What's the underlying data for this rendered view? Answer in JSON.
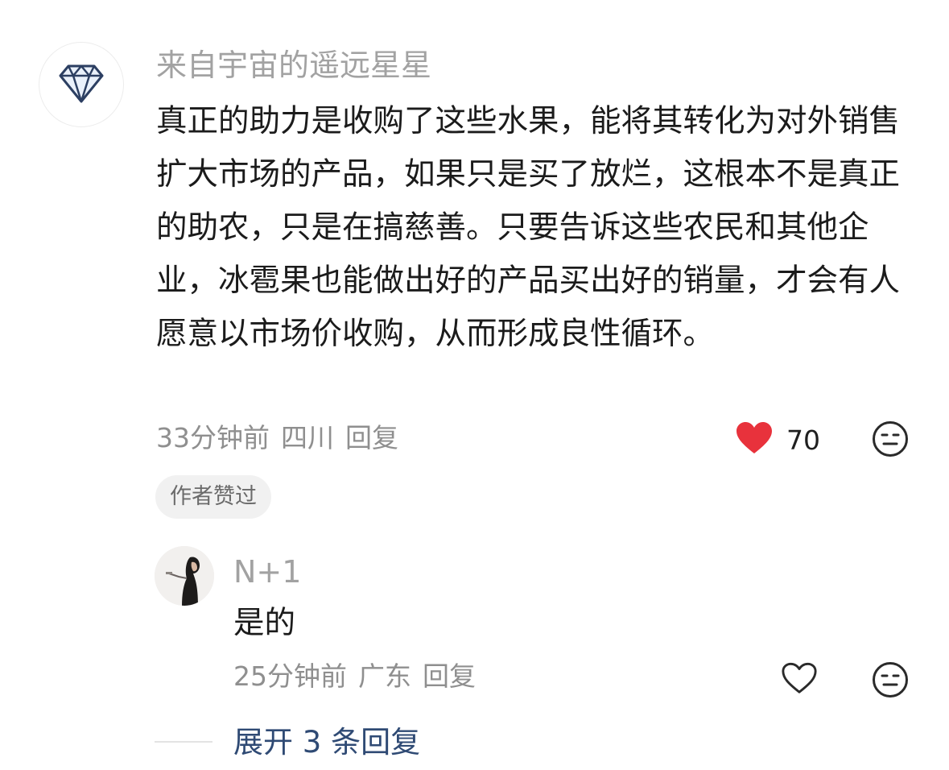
{
  "main_comment": {
    "username": "来自宇宙的遥远星星",
    "text": "真正的助力是收购了这些水果，能将其转化为对外销售扩大市场的产品，如果只是买了放烂，这根本不是真正的助农，只是在搞慈善。只要告诉这些农民和其他企业，冰雹果也能做出好的产品买出好的销量，才会有人愿意以市场价收购，从而形成良性循环。",
    "time": "33分钟前",
    "location": "四川",
    "reply_label": "回复",
    "like_count": "70",
    "liked": true,
    "badge": "作者赞过",
    "avatar_icon": "diamond-icon"
  },
  "reply": {
    "username": "N+1",
    "text": "是的",
    "time": "25分钟前",
    "location": "广东",
    "reply_label": "回复",
    "liked": false
  },
  "expand": {
    "label": "展开 3 条回复"
  },
  "colors": {
    "like_red": "#e8323c",
    "meta_gray": "#8f8f8f",
    "link_blue": "#2f4a74",
    "username_gray": "#a2a2a2"
  }
}
